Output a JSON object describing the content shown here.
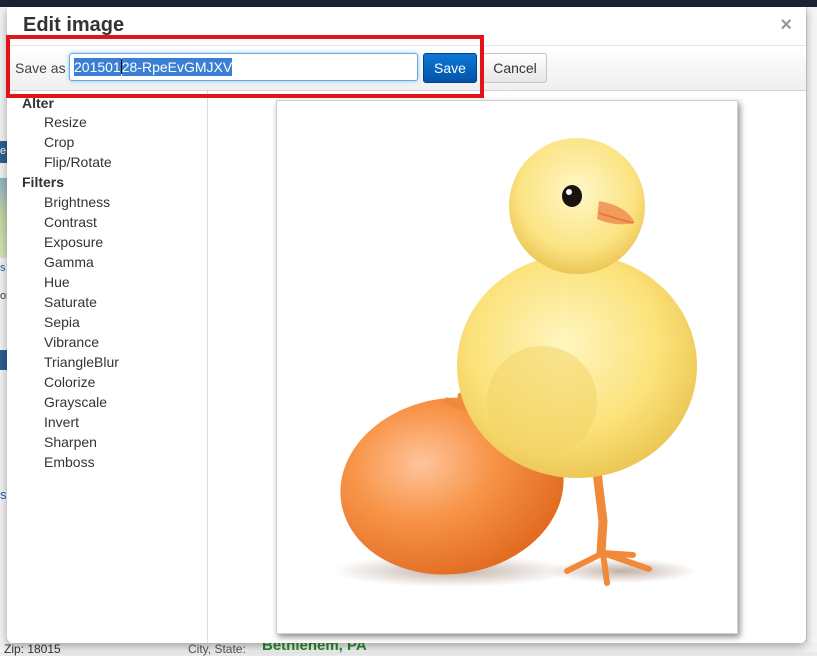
{
  "dialog": {
    "title": "Edit image",
    "close_icon": "×"
  },
  "toolbar": {
    "save_as_label": "Save as",
    "filename": {
      "selected_part_1": "201501",
      "selected_part_2": "28-RpeEvGMJXV"
    },
    "save_label": "Save",
    "cancel_label": "Cancel"
  },
  "sidebar": {
    "alter_heading": "Alter",
    "alter_items": [
      "Resize",
      "Crop",
      "Flip/Rotate"
    ],
    "filters_heading": "Filters",
    "filter_items": [
      "Brightness",
      "Contrast",
      "Exposure",
      "Gamma",
      "Hue",
      "Saturate",
      "Sepia",
      "Vibrance",
      "TriangleBlur",
      "Colorize",
      "Grayscale",
      "Invert",
      "Sharpen",
      "Emboss"
    ]
  },
  "background": {
    "frag_e": "e",
    "frag_s": "s",
    "frag_or": "or",
    "zip_label": "Zip: 18015",
    "city_label": "City, State:",
    "city_value": "Bethlehem, PA"
  },
  "colors": {
    "highlight": "#e0141a",
    "primary_button": "#0553a8"
  }
}
